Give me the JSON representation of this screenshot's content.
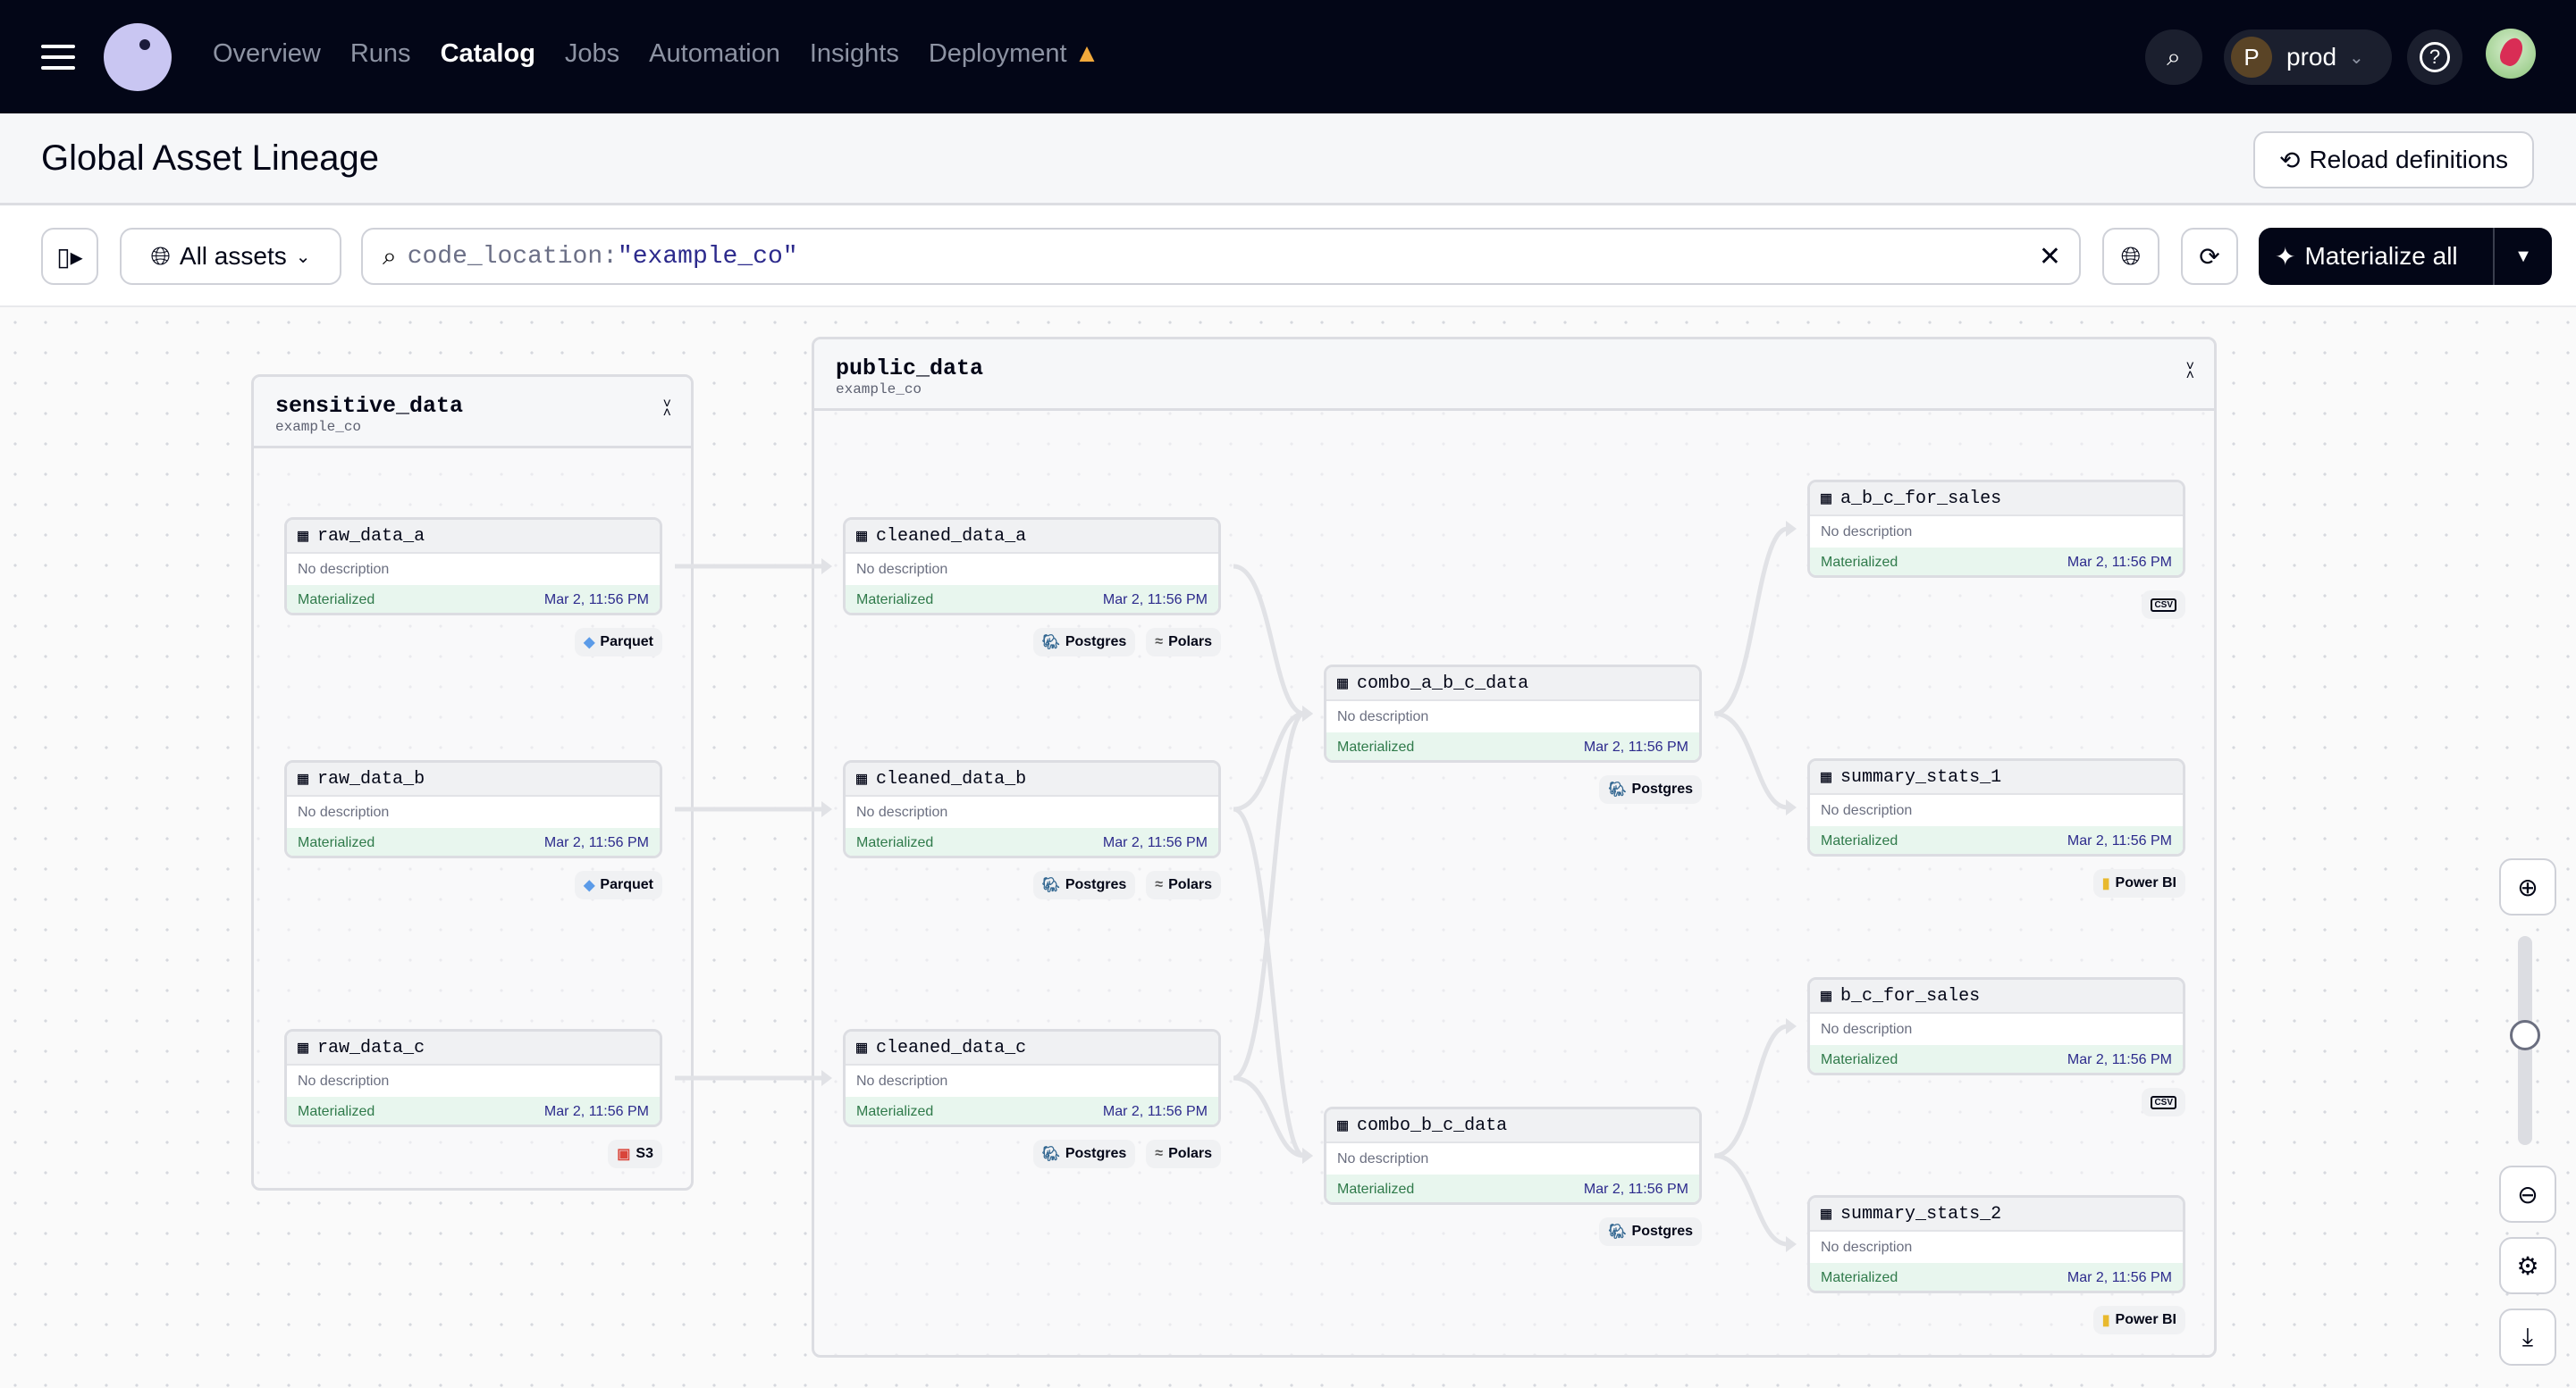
{
  "topnav": {
    "items": [
      "Overview",
      "Runs",
      "Catalog",
      "Jobs",
      "Automation",
      "Insights",
      "Deployment"
    ],
    "active": "Catalog",
    "deployment_warning": "warning-icon",
    "deployment_label": "prod",
    "deployment_initial": "P"
  },
  "header": {
    "title": "Global Asset Lineage",
    "reload_label": "Reload definitions"
  },
  "toolbar": {
    "scope_label": "All assets",
    "query_key": "code_location:",
    "query_value": "\"example_co\"",
    "materialize_label": "Materialize all"
  },
  "groups": [
    {
      "name": "sensitive_data",
      "location": "example_co"
    },
    {
      "name": "public_data",
      "location": "example_co"
    }
  ],
  "nodes": [
    {
      "name": "raw_data_a",
      "group": "sensitive_data",
      "description": "No description",
      "status": "Materialized",
      "timestamp": "Mar 2, 11:56 PM",
      "tags": [
        "Parquet"
      ]
    },
    {
      "name": "raw_data_b",
      "group": "sensitive_data",
      "description": "No description",
      "status": "Materialized",
      "timestamp": "Mar 2, 11:56 PM",
      "tags": [
        "Parquet"
      ]
    },
    {
      "name": "raw_data_c",
      "group": "sensitive_data",
      "description": "No description",
      "status": "Materialized",
      "timestamp": "Mar 2, 11:56 PM",
      "tags": [
        "S3"
      ]
    },
    {
      "name": "cleaned_data_a",
      "group": "public_data",
      "description": "No description",
      "status": "Materialized",
      "timestamp": "Mar 2, 11:56 PM",
      "tags": [
        "Postgres",
        "Polars"
      ]
    },
    {
      "name": "cleaned_data_b",
      "group": "public_data",
      "description": "No description",
      "status": "Materialized",
      "timestamp": "Mar 2, 11:56 PM",
      "tags": [
        "Postgres",
        "Polars"
      ]
    },
    {
      "name": "cleaned_data_c",
      "group": "public_data",
      "description": "No description",
      "status": "Materialized",
      "timestamp": "Mar 2, 11:56 PM",
      "tags": [
        "Postgres",
        "Polars"
      ]
    },
    {
      "name": "combo_a_b_c_data",
      "group": "public_data",
      "description": "No description",
      "status": "Materialized",
      "timestamp": "Mar 2, 11:56 PM",
      "tags": [
        "Postgres"
      ]
    },
    {
      "name": "combo_b_c_data",
      "group": "public_data",
      "description": "No description",
      "status": "Materialized",
      "timestamp": "Mar 2, 11:56 PM",
      "tags": [
        "Postgres"
      ]
    },
    {
      "name": "a_b_c_for_sales",
      "group": "public_data",
      "description": "No description",
      "status": "Materialized",
      "timestamp": "Mar 2, 11:56 PM",
      "tags": [
        "csv"
      ]
    },
    {
      "name": "summary_stats_1",
      "group": "public_data",
      "description": "No description",
      "status": "Materialized",
      "timestamp": "Mar 2, 11:56 PM",
      "tags": [
        "Power BI"
      ]
    },
    {
      "name": "b_c_for_sales",
      "group": "public_data",
      "description": "No description",
      "status": "Materialized",
      "timestamp": "Mar 2, 11:56 PM",
      "tags": [
        "csv"
      ]
    },
    {
      "name": "summary_stats_2",
      "group": "public_data",
      "description": "No description",
      "status": "Materialized",
      "timestamp": "Mar 2, 11:56 PM",
      "tags": [
        "Power BI"
      ]
    }
  ],
  "edges": [
    [
      "raw_data_a",
      "cleaned_data_a"
    ],
    [
      "raw_data_b",
      "cleaned_data_b"
    ],
    [
      "raw_data_c",
      "cleaned_data_c"
    ],
    [
      "cleaned_data_a",
      "combo_a_b_c_data"
    ],
    [
      "cleaned_data_b",
      "combo_a_b_c_data"
    ],
    [
      "cleaned_data_c",
      "combo_a_b_c_data"
    ],
    [
      "cleaned_data_b",
      "combo_b_c_data"
    ],
    [
      "cleaned_data_c",
      "combo_b_c_data"
    ],
    [
      "combo_a_b_c_data",
      "a_b_c_for_sales"
    ],
    [
      "combo_a_b_c_data",
      "summary_stats_1"
    ],
    [
      "combo_b_c_data",
      "b_c_for_sales"
    ],
    [
      "combo_b_c_data",
      "summary_stats_2"
    ]
  ],
  "colors": {
    "topbar": "#030617",
    "materialized_bg": "#e8f6ee",
    "materialized_text": "#2f7a4a",
    "timestamp_text": "#2c2a8c",
    "warning": "#f2a93b"
  }
}
